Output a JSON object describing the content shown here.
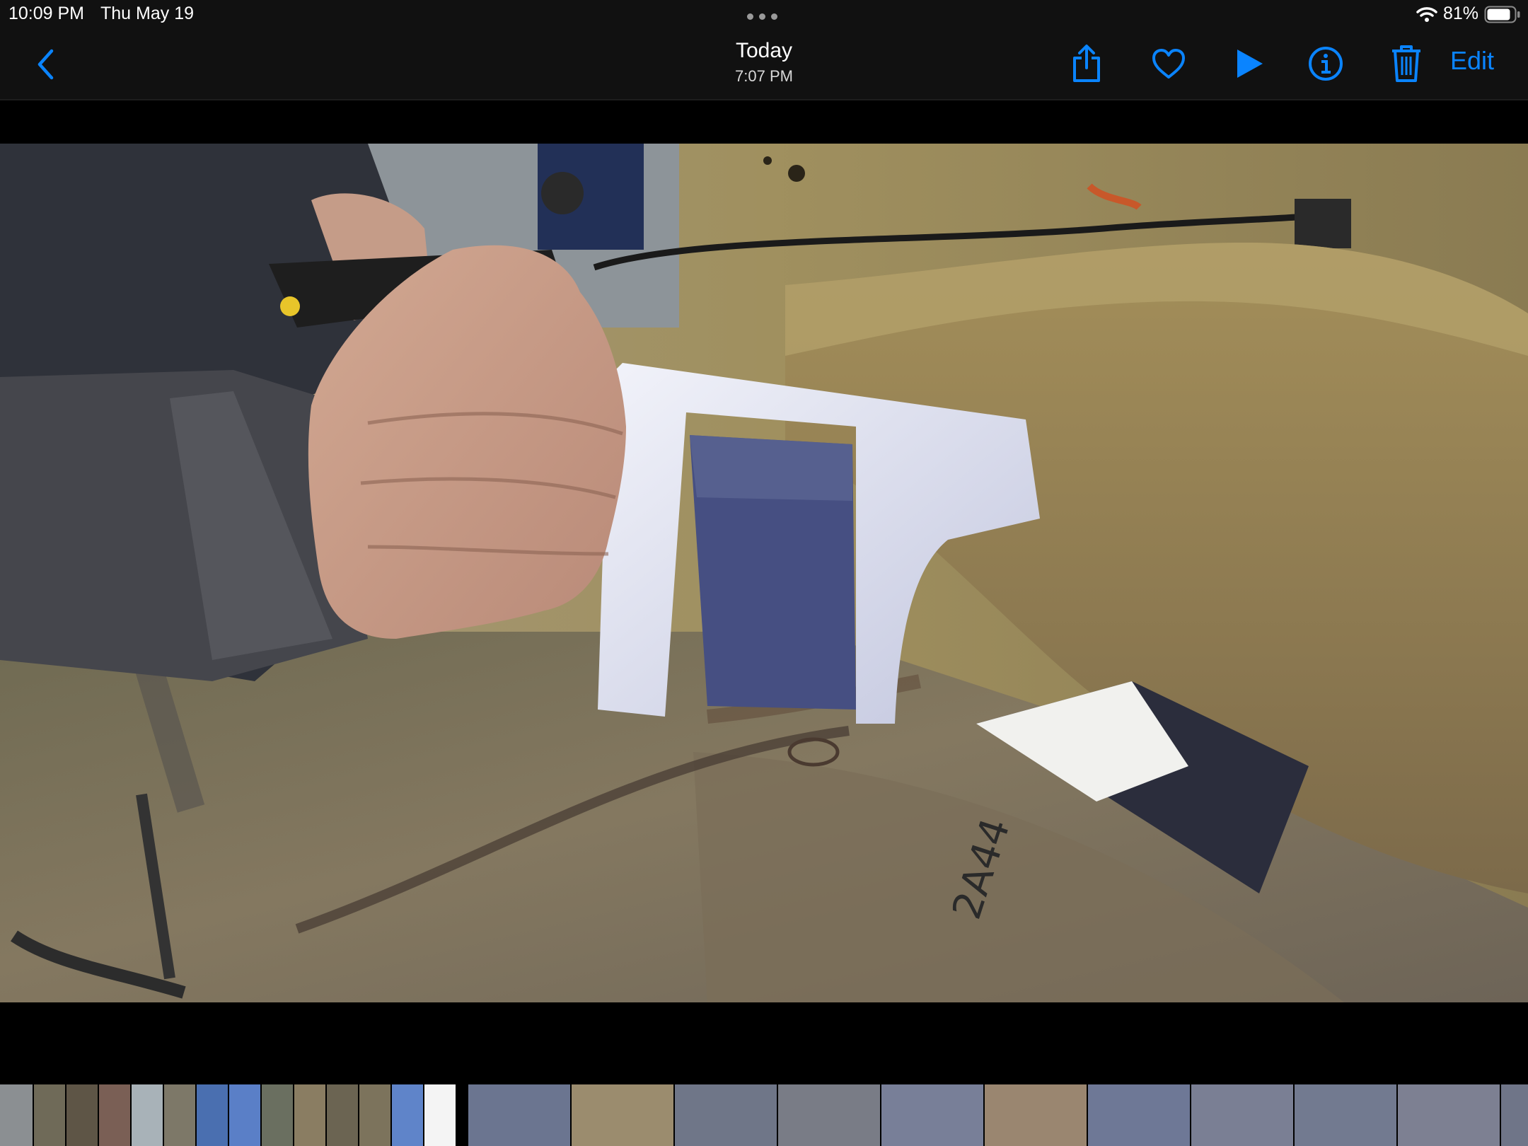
{
  "status_bar": {
    "time": "10:09 PM",
    "date": "Thu May 19",
    "battery": "81%"
  },
  "nav": {
    "title": "Today",
    "subtitle": "7:07 PM",
    "edit_label": "Edit"
  },
  "icons": {
    "back": "chevron-left-icon",
    "share": "share-icon",
    "favorite": "heart-icon",
    "play": "play-icon",
    "info": "info-icon",
    "delete": "trash-icon"
  },
  "colors": {
    "accent": "#0a84ff",
    "bar_background": "#111111"
  },
  "photo": {
    "marking": "2A44"
  }
}
